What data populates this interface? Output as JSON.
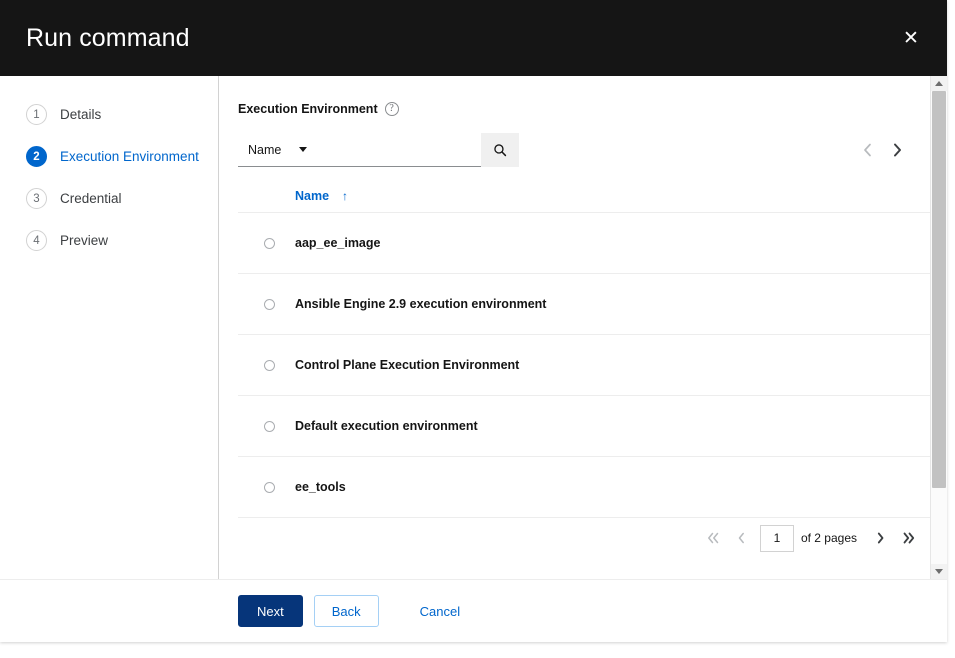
{
  "header": {
    "title": "Run command",
    "close_label": "✕"
  },
  "wizard_nav": {
    "steps": [
      {
        "number": "1",
        "label": "Details",
        "active": false
      },
      {
        "number": "2",
        "label": "Execution Environment",
        "active": true
      },
      {
        "number": "3",
        "label": "Credential",
        "active": false
      },
      {
        "number": "4",
        "label": "Preview",
        "active": false
      }
    ]
  },
  "field": {
    "label": "Execution Environment",
    "help_icon": "?"
  },
  "toolbar": {
    "filter_attribute": "Name",
    "search_value": "",
    "search_placeholder": "",
    "search_icon": "search-icon"
  },
  "top_pager": {
    "prev_label": "‹",
    "next_label": "›",
    "prev_disabled": true,
    "next_disabled": false
  },
  "table": {
    "columns": [
      {
        "label": "Name",
        "sort_direction": "↑"
      }
    ],
    "rows": [
      {
        "name": "aap_ee_image",
        "selected": false
      },
      {
        "name": "Ansible Engine 2.9 execution environment",
        "selected": false
      },
      {
        "name": "Control Plane Execution Environment",
        "selected": false
      },
      {
        "name": "Default execution environment",
        "selected": false
      },
      {
        "name": "ee_tools",
        "selected": false
      }
    ]
  },
  "bottom_pager": {
    "first_label": "«",
    "prev_label": "‹",
    "current_page": "1",
    "pages_text": "of 2 pages",
    "next_label": "›",
    "last_label": "»",
    "first_disabled": true,
    "prev_disabled": true,
    "next_disabled": false,
    "last_disabled": false
  },
  "footer": {
    "next_label": "Next",
    "back_label": "Back",
    "cancel_label": "Cancel"
  },
  "colors": {
    "header_bg": "#151515",
    "accent_blue": "#0066cc",
    "primary_button": "#06357a",
    "disabled_grey": "#b8bbbe",
    "enabled_chevron": "#3c3f42"
  }
}
